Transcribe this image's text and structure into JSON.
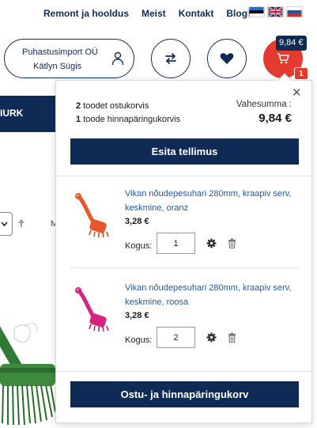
{
  "topnav": {
    "links": [
      "Remont ja hooldus",
      "Meist",
      "Kontakt",
      "Blogi"
    ]
  },
  "languages": [
    "Eesti",
    "English",
    "Русский"
  ],
  "account": {
    "company": "Puhastusimport OÜ",
    "person": "Kätlyn Sügis"
  },
  "header": {
    "icons": [
      "compare-icon",
      "heart-icon",
      "cart-icon"
    ],
    "cart_total": "9,84 €",
    "cart_count": "1"
  },
  "background": {
    "category_fragment": "IURK",
    "sort_fragment": "M"
  },
  "mini_cart": {
    "line1_count": "2",
    "line1_text": "toodet ostukorvis",
    "line2_count": "1",
    "line2_text": "toode hinnapäringukorvis",
    "subtotal_label": "Vahesumma :",
    "subtotal_value": "9,84 €",
    "checkout_label": "Esita tellimus",
    "qty_label": "Kogus:",
    "items": [
      {
        "name": "Vikan nõudepesuhari 280mm, kraapiv serv, keskmine, oranz",
        "price": "3,28 €",
        "qty": "1",
        "color": "#e8572a"
      },
      {
        "name": "Vikan nõudepesuhari 280mm, kraapiv serv, keskmine, roosa",
        "price": "3,28 €",
        "qty": "2",
        "color": "#d4267e"
      }
    ],
    "view_cart_label": "Ostu- ja hinnapäringukorv"
  },
  "colors": {
    "navy": "#0f2b55",
    "red": "#e53a2f",
    "link": "#1e5a9e"
  }
}
